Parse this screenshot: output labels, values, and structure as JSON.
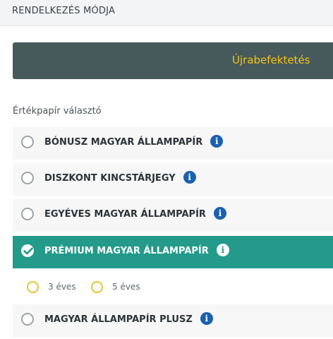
{
  "header": {
    "title": "RENDELKEZÉS MÓDJA"
  },
  "reinvest": {
    "label": "Újrabefektetés",
    "accent_color": "#f4c21a",
    "background_color": "#465a5c"
  },
  "securities": {
    "section_label": "Értékpapír választó",
    "selected_color": "#239a8a",
    "options": [
      {
        "label": "BÓNUSZ MAGYAR ÁLLAMPAPÍR",
        "selected": false,
        "icon": "info-icon"
      },
      {
        "label": "DISZKONT KINCSTÁRJEGY",
        "selected": false,
        "icon": "info-icon"
      },
      {
        "label": "EGYÉVES MAGYAR ÁLLAMPAPÍR",
        "selected": false,
        "icon": "info-icon"
      },
      {
        "label": "PRÉMIUM MAGYAR ÁLLAMPAPÍR",
        "selected": true,
        "icon": "info-icon"
      },
      {
        "label": "MAGYAR ÁLLAMPAPÍR PLUSZ",
        "selected": false,
        "icon": "info-icon"
      }
    ],
    "term_options": [
      {
        "label": "3 éves",
        "selected": false
      },
      {
        "label": "5 éves",
        "selected": false
      }
    ]
  },
  "info_glyph": "i"
}
